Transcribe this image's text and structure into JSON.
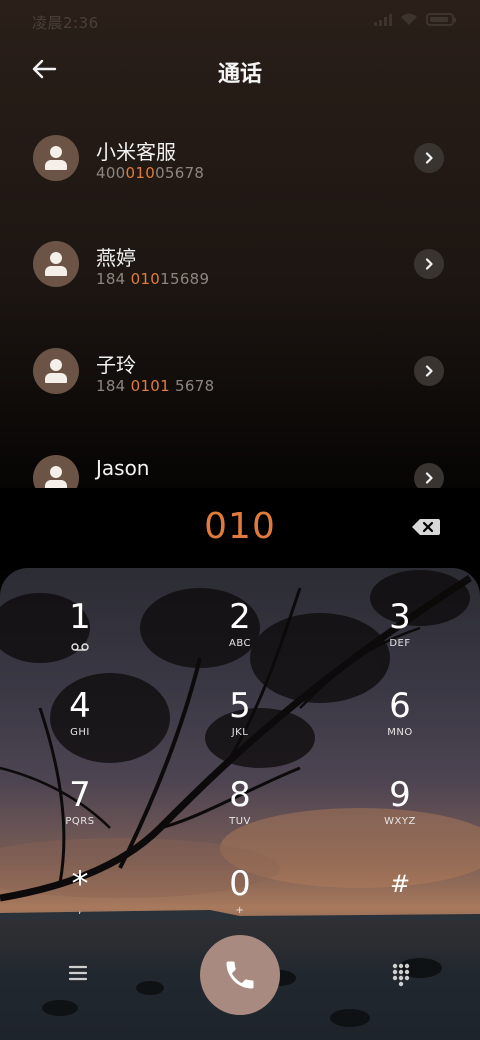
{
  "status_bar": {
    "time": "凌晨2:36"
  },
  "header": {
    "title": "通话"
  },
  "contacts": [
    {
      "name": "小米客服",
      "number_parts": [
        "400",
        "010",
        "05678"
      ]
    },
    {
      "name": "燕婷",
      "number_parts": [
        "184 ",
        "010",
        "15689"
      ]
    },
    {
      "name": "子玲",
      "number_parts": [
        "184 ",
        "0101",
        " 5678"
      ]
    },
    {
      "name": "Jason",
      "number_parts": [
        "",
        "",
        ""
      ]
    }
  ],
  "dialer": {
    "number": "010",
    "keys": [
      {
        "digit": "1",
        "letters": ""
      },
      {
        "digit": "2",
        "letters": "ABC"
      },
      {
        "digit": "3",
        "letters": "DEF"
      },
      {
        "digit": "4",
        "letters": "GHI"
      },
      {
        "digit": "5",
        "letters": "JKL"
      },
      {
        "digit": "6",
        "letters": "MNO"
      },
      {
        "digit": "7",
        "letters": "PQRS"
      },
      {
        "digit": "8",
        "letters": "TUV"
      },
      {
        "digit": "9",
        "letters": "WXYZ"
      },
      {
        "digit": "*",
        "letters": ","
      },
      {
        "digit": "0",
        "letters": "+"
      },
      {
        "digit": "#",
        "letters": ""
      }
    ]
  },
  "icons": {
    "back": "arrow-left-icon",
    "detail": "chevron-right-icon",
    "backspace": "backspace-icon",
    "menu": "menu-icon",
    "call": "phone-icon",
    "keypad": "dialpad-icon",
    "voicemail": "voicemail-icon"
  },
  "colors": {
    "accent": "#e07b3c",
    "call_button": "#a88a80",
    "avatar": "#6b5446"
  }
}
